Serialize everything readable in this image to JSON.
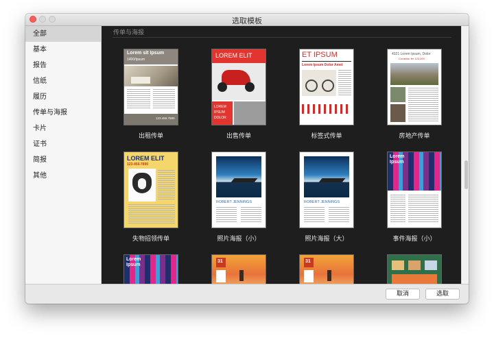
{
  "window": {
    "title": "选取模板"
  },
  "sidebar": {
    "items": [
      {
        "label": "全部"
      },
      {
        "label": "基本"
      },
      {
        "label": "报告"
      },
      {
        "label": "信纸"
      },
      {
        "label": "履历"
      },
      {
        "label": "传单与海报"
      },
      {
        "label": "卡片"
      },
      {
        "label": "证书"
      },
      {
        "label": "简报"
      },
      {
        "label": "其他"
      }
    ]
  },
  "section": {
    "title": "传单与海报"
  },
  "templates": [
    {
      "name": "出租传单",
      "heading": "Lorem sit Ipsum",
      "sub": "1400/Ipsum",
      "footer": "123.456.7890"
    },
    {
      "name": "出售传单",
      "heading": "LOREM ELIT",
      "sub": "LOREM IPSUM DOLOR"
    },
    {
      "name": "标签式传单",
      "heading": "ET IPSUM",
      "sub": "Lorem Ipsum Dolor Amet"
    },
    {
      "name": "房地产传单",
      "heading": "4321 Lorem Ipsum, Dolor",
      "sub": "Curabitur fer 123,000"
    },
    {
      "name": "失物招领传单",
      "heading": "LOREM ELIT",
      "sub": "123-456-7890"
    },
    {
      "name": "照片海报（小）",
      "heading": "ROBERT JENNINGS"
    },
    {
      "name": "照片海报（大）",
      "heading": "ROBERT JENNINGS"
    },
    {
      "name": "事件海报（小）",
      "heading": "Lorem Ipsum"
    },
    {
      "name": "",
      "heading": "Lorem Ipsum"
    },
    {
      "name": "",
      "badge": "31"
    },
    {
      "name": "",
      "badge": "31"
    },
    {
      "name": ""
    }
  ],
  "footer": {
    "cancel": "取消",
    "choose": "选取"
  }
}
